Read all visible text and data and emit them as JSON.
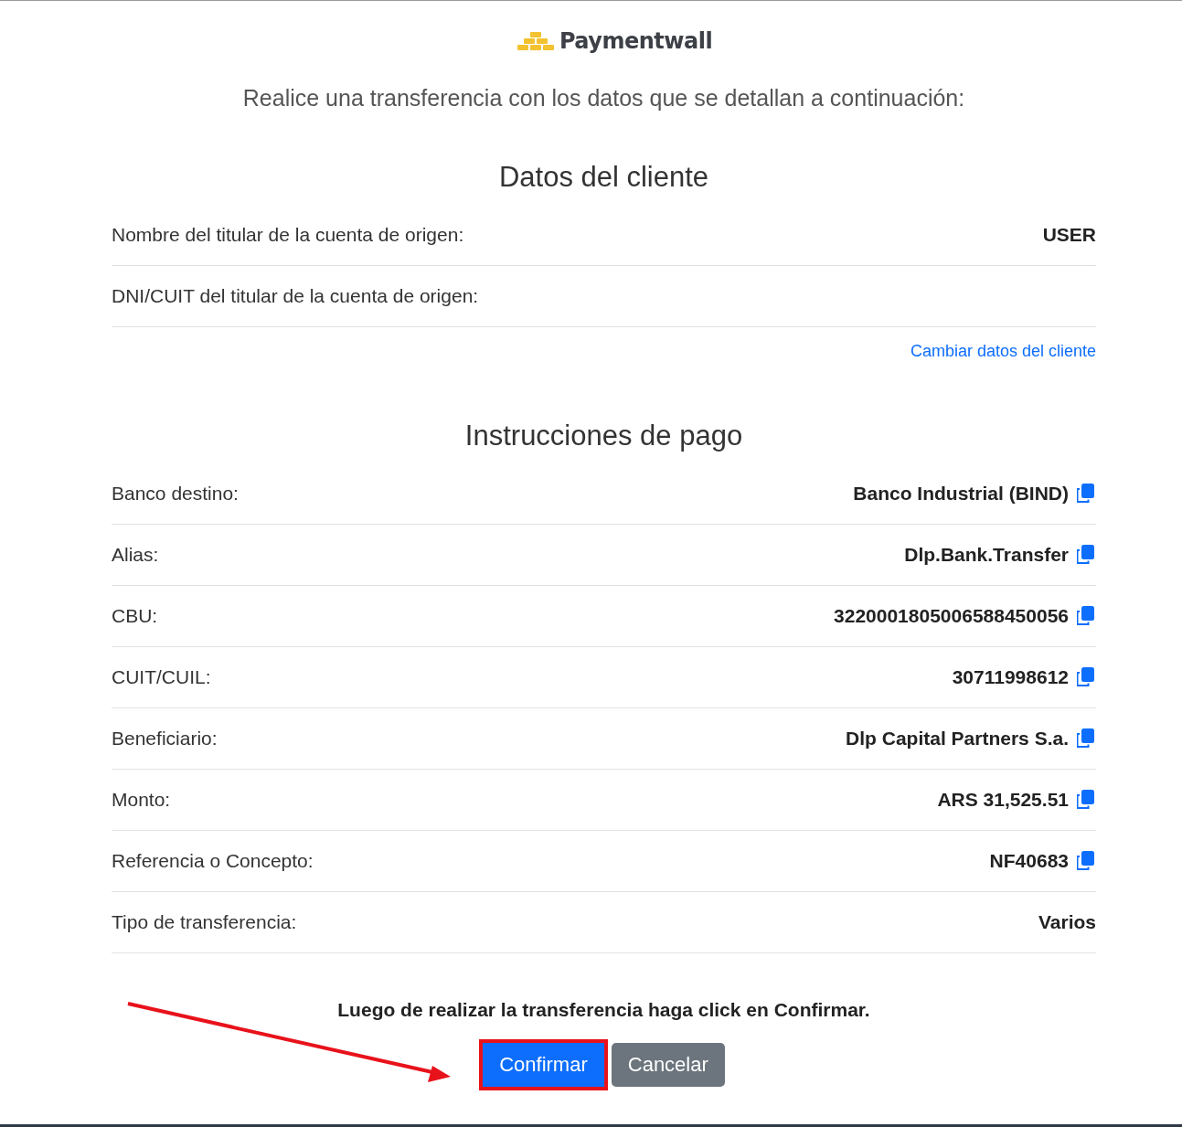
{
  "logo": {
    "text": "Paymentwall"
  },
  "intro": "Realice una transferencia con los datos que se detallan a continuación:",
  "client": {
    "heading": "Datos del cliente",
    "rows": [
      {
        "label": "Nombre del titular de la cuenta de origen:",
        "value": "USER"
      },
      {
        "label": "DNI/CUIT del titular de la cuenta de origen:"
      }
    ],
    "change_link": "Cambiar datos del cliente"
  },
  "payment": {
    "heading": "Instrucciones de pago",
    "rows": [
      {
        "label": "Banco destino:",
        "value": "Banco Industrial (BIND)",
        "copyable": true
      },
      {
        "label": "Alias:",
        "value": "Dlp.Bank.Transfer",
        "copyable": true
      },
      {
        "label": "CBU:",
        "value": "3220001805006588450056",
        "copyable": true
      },
      {
        "label": "CUIT/CUIL:",
        "value": "30711998612",
        "copyable": true
      },
      {
        "label": "Beneficiario:",
        "value": "Dlp Capital Partners S.a.",
        "copyable": true
      },
      {
        "label": "Monto:",
        "value": "ARS 31,525.51",
        "copyable": true
      },
      {
        "label": "Referencia o Concepto:",
        "value": "NF40683",
        "copyable": true
      },
      {
        "label": "Tipo de transferencia:",
        "value": "Varios",
        "copyable": false
      }
    ]
  },
  "note": "Luego de realizar la transferencia haga click en Confirmar.",
  "buttons": [
    {
      "label": "Confirmar",
      "kind": "primary",
      "highlighted": true
    },
    {
      "label": "Cancelar",
      "kind": "secondary",
      "highlighted": false
    }
  ],
  "annotation": {
    "kind": "arrow"
  }
}
